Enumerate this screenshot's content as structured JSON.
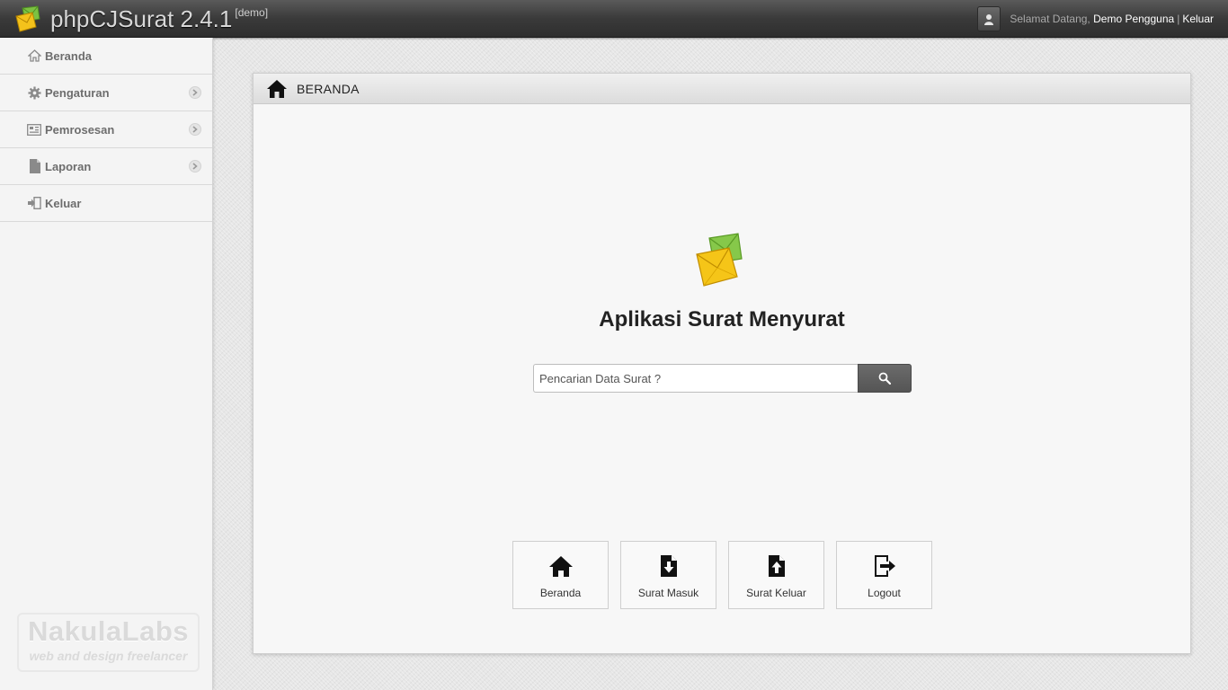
{
  "header": {
    "title": "phpCJSurat 2.4.1",
    "tag": "[demo]",
    "welcome": "Selamat Datang,",
    "user_name": "Demo Pengguna",
    "separator": "|",
    "logout": "Keluar"
  },
  "sidebar": {
    "items": [
      {
        "label": "Beranda",
        "icon": "home-icon",
        "has_submenu": false
      },
      {
        "label": "Pengaturan",
        "icon": "gear-icon",
        "has_submenu": true
      },
      {
        "label": "Pemrosesan",
        "icon": "process-icon",
        "has_submenu": true
      },
      {
        "label": "Laporan",
        "icon": "document-icon",
        "has_submenu": true
      },
      {
        "label": "Keluar",
        "icon": "exit-icon",
        "has_submenu": false
      }
    ],
    "watermark": {
      "title": "NakulaLabs",
      "subtitle": "web and design freelancer"
    }
  },
  "panel": {
    "title": "BERANDA",
    "app_title": "Aplikasi Surat Menyurat",
    "search": {
      "placeholder": "Pencarian Data Surat ?"
    },
    "shortcuts": [
      {
        "label": "Beranda",
        "icon": "home-icon"
      },
      {
        "label": "Surat Masuk",
        "icon": "incoming-mail-icon"
      },
      {
        "label": "Surat Keluar",
        "icon": "outgoing-mail-icon"
      },
      {
        "label": "Logout",
        "icon": "logout-icon"
      }
    ]
  },
  "colors": {
    "topbar": "#3a3a3a",
    "sidebar": "#f4f4f4",
    "panel": "#f7f7f7",
    "search_button": "#5e5e5e",
    "envelope_green": "#8bc34a",
    "envelope_yellow": "#f5c518"
  }
}
